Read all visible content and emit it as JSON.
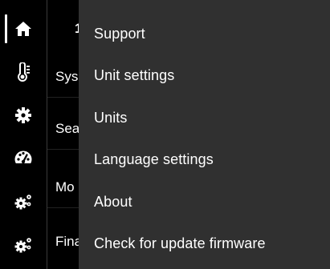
{
  "rail": {
    "items": [
      {
        "icon": "home-icon",
        "active": true
      },
      {
        "icon": "thermometer-icon",
        "active": false
      },
      {
        "icon": "gear-icon",
        "active": false
      },
      {
        "icon": "gauge-icon",
        "active": false
      },
      {
        "icon": "gears-icon",
        "active": false
      },
      {
        "icon": "gears-icon",
        "active": false
      }
    ]
  },
  "list": {
    "rows": [
      "1",
      "Sys",
      "Sea",
      "Mo",
      "Fina"
    ]
  },
  "menu": {
    "items": [
      "Support",
      "Unit settings",
      "Units",
      "Language settings",
      "About",
      "Check for update firmware"
    ]
  },
  "colors": {
    "background": "#000000",
    "menu_background": "#303030",
    "text": "#ffffff"
  }
}
